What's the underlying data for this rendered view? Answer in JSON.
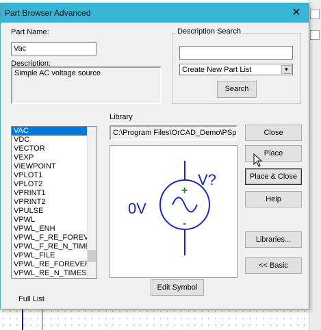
{
  "window": {
    "title": "Part Browser Advanced",
    "close_glyph": "✕"
  },
  "part_name": {
    "label": "Part Name:",
    "value": "Vac"
  },
  "description": {
    "label": "Description:",
    "value": "Simple AC voltage source"
  },
  "description_search": {
    "legend": "Description Search",
    "query": "",
    "dropdown_value": "Create New Part List",
    "search_label": "Search"
  },
  "part_list": {
    "items": [
      "VAC",
      "VDC",
      "VECTOR",
      "VEXP",
      "VIEWPOINT",
      "VPLOT1",
      "VPLOT2",
      "VPRINT1",
      "VPRINT2",
      "VPULSE",
      "VPWL",
      "VPWL_ENH",
      "VPWL_F_RE_FOREVER",
      "VPWL_F_RE_N_TIMES",
      "VPWL_FILE",
      "VPWL_RE_FOREVER",
      "VPWL_RE_N_TIMES"
    ],
    "selected_index": 0,
    "footer_label": "Full List"
  },
  "library": {
    "label": "Library",
    "path": "C:\\Program Files\\OrCAD_Demo\\PSpice\\Library\\SOURCE.OLB"
  },
  "preview": {
    "ref_label": "V?",
    "value_label": "0V",
    "plus": "+",
    "minus": "-",
    "symbol_color": "#1a28b5",
    "pin_mark_color": "#1a8a1a"
  },
  "buttons": {
    "close": "Close",
    "place": "Place",
    "place_close": "Place & Close",
    "help": "Help",
    "libraries": "Libraries...",
    "basic": "<< Basic",
    "edit_symbol": "Edit Symbol"
  },
  "colors": {
    "titlebar": "#37b4d6",
    "selection": "#0078d7",
    "schematic_wire": "#1a1f8a"
  }
}
